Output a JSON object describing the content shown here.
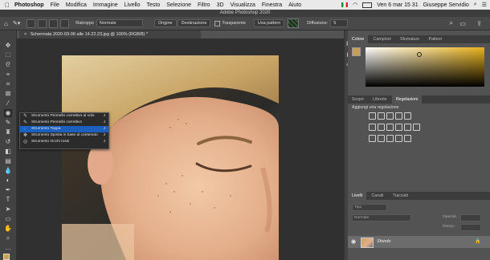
{
  "menubar": {
    "app": "Photoshop",
    "items": [
      "File",
      "Modifica",
      "Immagine",
      "Livello",
      "Testo",
      "Selezione",
      "Filtro",
      "3D",
      "Visualizza",
      "Finestra",
      "Aiuto"
    ],
    "clock": "Ven 6 mar  15 31",
    "user": "Giuseppe Servidio"
  },
  "window_title": "Adobe Photoshop 2020",
  "options": {
    "feather_label": "Ratroppo",
    "blend_value": "Normale",
    "source_label": "Origine",
    "destination_label": "Destinazione",
    "transparent_label": "Trasparente",
    "use_pattern_label": "Usa pattern",
    "diffusion_label": "Diffusione:",
    "diffusion_value": "5"
  },
  "document_tab": "Schermata 2020-03-06 alle 14.22.23.jpg @ 100% (RGB/8) *",
  "flyout": [
    {
      "label": "Strumento Pennello correttivo al volo",
      "key": "J"
    },
    {
      "label": "Strumento Pennello correttivo",
      "key": "J"
    },
    {
      "label": "Strumento Toppa",
      "key": "J"
    },
    {
      "label": "Strumento Sposta in base al contenuto",
      "key": "J"
    },
    {
      "label": "Strumento Occhi rossi",
      "key": "J"
    }
  ],
  "color_panel": {
    "tabs": [
      "Colore",
      "Campioni",
      "Sfumature",
      "Pattern"
    ],
    "foreground": "#c8a055",
    "background": "#ffffff"
  },
  "adjust_panel": {
    "tabs": [
      "Scopri",
      "Librerie",
      "Regolazioni"
    ],
    "heading": "Aggiungi una regolazione"
  },
  "layers_panel": {
    "tabs": [
      "Livelli",
      "Canali",
      "Tracciati"
    ],
    "kind_label": "Tipo",
    "mode_label": "Normale",
    "opacity_label": "Opacità:",
    "fill_label": "Riemp.:",
    "layer_name": "Sfondo"
  }
}
